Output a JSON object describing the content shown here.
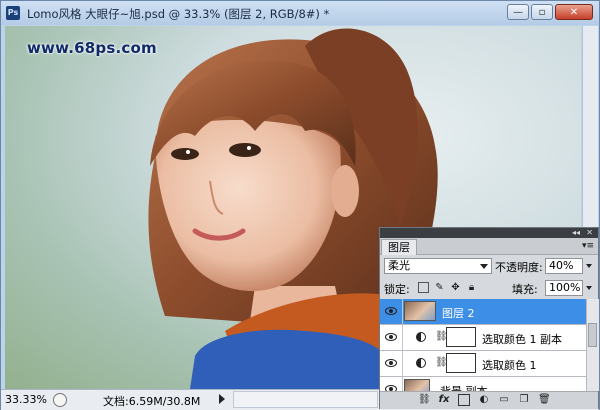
{
  "window": {
    "title": "Lomo风格  大眼仔~旭.psd @ 33.3% (图层 2, RGB/8#) *",
    "app_icon": "Ps",
    "buttons": {
      "minimize": "—",
      "restore": "▫",
      "close": "✕"
    }
  },
  "canvas": {
    "watermark": "www.68ps.com"
  },
  "statusbar": {
    "zoom": "33.33%",
    "doc_info": "文档:6.59M/30.8M"
  },
  "layers_panel": {
    "tab_label": "图层",
    "blend_mode": "柔光",
    "opacity_label": "不透明度:",
    "opacity_value": "40%",
    "lock_label": "锁定:",
    "fill_label": "填充:",
    "fill_value": "100%",
    "layers": [
      {
        "name": "图层 2",
        "selected": true,
        "kind": "image"
      },
      {
        "name": "选取颜色 1 副本",
        "selected": false,
        "kind": "adjustment"
      },
      {
        "name": "选取颜色 1",
        "selected": false,
        "kind": "adjustment"
      },
      {
        "name": "背景 副本",
        "selected": false,
        "kind": "image"
      }
    ]
  },
  "icons": {
    "eye": "eye-icon",
    "link": "chain-icon",
    "lock_transparency": "lock-transparency-icon",
    "lock_paint": "brush-icon",
    "lock_move": "move-icon",
    "lock_all": "padlock-icon"
  }
}
